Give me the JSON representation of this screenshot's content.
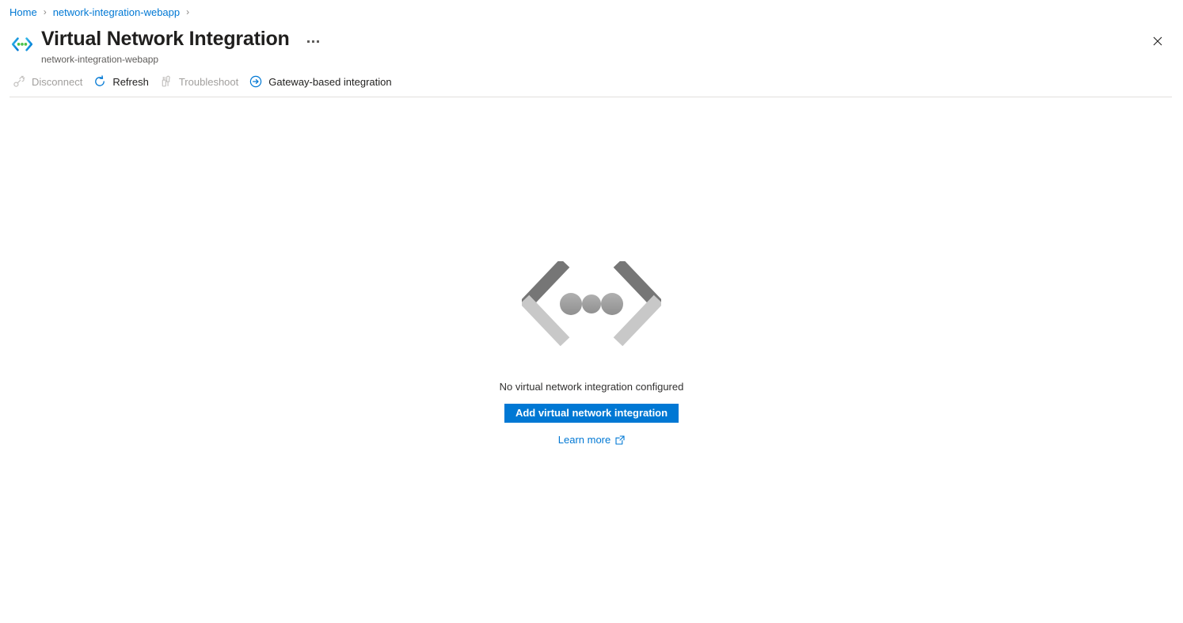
{
  "breadcrumb": {
    "items": [
      {
        "label": "Home",
        "icon": ""
      },
      {
        "label": "network-integration-webapp",
        "icon": ""
      }
    ],
    "separator": "›"
  },
  "header": {
    "icon": "virtual-network-integration-icon",
    "title": "Virtual Network Integration",
    "subtitle": "network-integration-webapp",
    "more_menu_label": "···",
    "close_label": "✕"
  },
  "toolbar": {
    "items": [
      {
        "label": "Disconnect",
        "icon": "disconnect-icon",
        "enabled": false
      },
      {
        "label": "Refresh",
        "icon": "refresh-icon",
        "enabled": true
      },
      {
        "label": "Troubleshoot",
        "icon": "troubleshoot-icon",
        "enabled": false
      },
      {
        "label": "Gateway-based integration",
        "icon": "arrow-circle-right-icon",
        "enabled": true
      }
    ]
  },
  "empty_state": {
    "illustration": "angle-brackets-dots-illustration",
    "message": "No virtual network integration configured",
    "primary_button": "Add virtual network integration",
    "link_label": "Learn more",
    "link_icon": "external-link-icon"
  },
  "colors": {
    "accent": "#0078d4",
    "link": "#0078d4",
    "disabled_text": "#a19f9d",
    "text": "#323130",
    "title": "#201f1e",
    "subtitle": "#605e5c",
    "divider": "#e1dfdd",
    "illustration_dark": "#767676",
    "illustration_light": "#c8c8c8",
    "illustration_dot": "#a0a0a0",
    "icon_green": "#4bc34b",
    "background": "#ffffff"
  }
}
